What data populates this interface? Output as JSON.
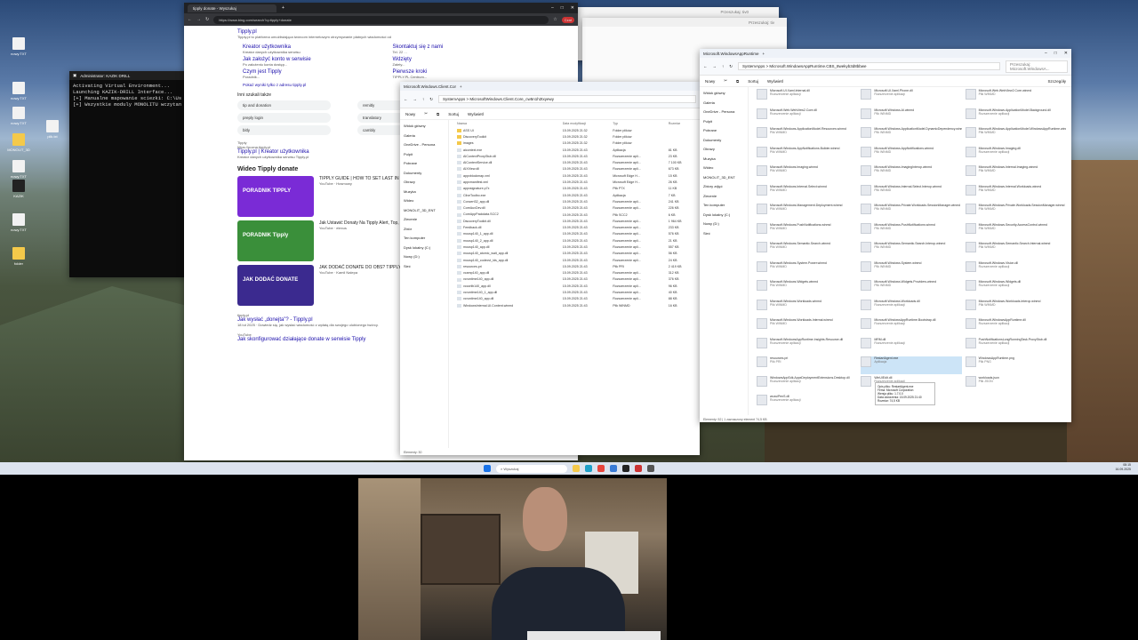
{
  "desktop": {
    "icons": [
      {
        "label": "nowy.TXT",
        "kind": "file"
      },
      {
        "label": "nowy.TXT",
        "kind": "file"
      },
      {
        "label": "nowy.TXT",
        "kind": "file"
      },
      {
        "label": "MONOLIT_3D",
        "kind": "folder"
      },
      {
        "label": "plik.txt",
        "kind": "file"
      },
      {
        "label": "nowy.TXT",
        "kind": "file"
      },
      {
        "label": "KAZIK",
        "kind": "dark"
      },
      {
        "label": "nowy.TXT",
        "kind": "file"
      },
      {
        "label": "folder",
        "kind": "folder"
      }
    ]
  },
  "terminal": {
    "title": "Administrator: KAZIK DRILL",
    "lines": "Activating Virtual Environment...\nLaunching KAZIK-DRILL Interface...\n[+] Manualne mapowanie sciezki: C:\\Us\n[+] Wszystkie moduly MONOLITU wczytan"
  },
  "browser": {
    "tab_title": "tipply donate - Wyszukaj",
    "url": "https://www.bing.com/search?q=tipply+donate",
    "top_link": "Tipply.pl",
    "top_desc": "Tipply.pl to platforma umożliwiająca twórcom internetowym otrzymywanie płatnych wiadomości od",
    "sublinks": [
      {
        "title": "Kreator użytkownika",
        "desc": "Kreator danych użytkownika serwisu"
      },
      {
        "title": "Skontaktuj się z nami",
        "desc": "Tel. 22 ..."
      },
      {
        "title": "Jak założyć konto w serwisie",
        "desc": "Po założeniu konta dostęp..."
      },
      {
        "title": "Wdzięty",
        "desc": "Zalety..."
      },
      {
        "title": "Czym jest Tipply",
        "desc": "Poradnik..."
      },
      {
        "title": "Pierwsze kroki",
        "desc": "TIPPLY.PL Centrum..."
      }
    ],
    "more_link": "Pokaż wyniki tylko z adresu tipply.pl",
    "also_searched": "Inni szukali także",
    "chips": [
      "tip and donation",
      "remitly",
      "preply login",
      "translatory",
      "bitly",
      "cambly"
    ],
    "result2_site": "Tipply",
    "result2_url": "https://pozna.tipply.pl",
    "result2_title": "Tipply.pl | Kreator użytkownika",
    "result2_desc": "Kreator danych użytkownika serwisu Tipply.pl",
    "video_heading": "Wideo Tipply donate",
    "videos": [
      {
        "title": "TIPPLY GUIDE | HOW TO SET LAST IN OBS",
        "source": "YouTube · Hosmowy",
        "thumb": "PORADNIK TIPPLY",
        "color": "#7a2bd6"
      },
      {
        "title": "Jak Ustawić Donaty Na Tipply Alert, Top, Last, Cel, Licznik",
        "source": "YouTube · elexus",
        "thumb": "PORADNIK Tipply",
        "color": "#3a8f3a"
      },
      {
        "title": "JAK DODAĆ DONATE DO OBS? TIPPLY",
        "source": "YouTube · Kamil Nalepa",
        "thumb": "JAK DODAĆ DONATE",
        "color": "#3b2a8f"
      }
    ],
    "result3_site": "tipply.pl",
    "result3_title": "Jak wysłać „donejta”? - Tipply.pl",
    "result3_desc": "18 lut 2025 · Dowiedz się, jak wysłać wiadomość z wpłatą dla swojego ulubionego twórcy.",
    "result4_site": "YouTube",
    "result4_title": "Jak skonfigurować działające donate w serwisie Tipply"
  },
  "explorer1": {
    "title": "Microsoft.Windows.Client.Cor",
    "breadcrumb": "SystemApps > MicrosoftWindows.Client.Core_cw5n1h2txyewy",
    "new_label": "Nowy",
    "sort_label": "Sortuj",
    "view_label": "Wyświetl",
    "side": [
      "Widok główny",
      "Galeria",
      "OneDrive - Persona",
      "Pulpit",
      "Pobrane",
      "Dokumenty",
      "Obrazy",
      "Muzyka",
      "Wideo",
      "MONOLIT_3D_ENT",
      "Zlecenie",
      "Zbiór",
      "Ten komputer",
      "Dysk lokalny (C:)",
      "Nowy (D:)",
      "Sieć"
    ],
    "headers": [
      "Nazwa",
      "Data modyfikacji",
      "Typ",
      "Rozmiar"
    ],
    "rows": [
      [
        "ASS UI",
        "15.09.2025 21:32",
        "Folder plików",
        "",
        "folder"
      ],
      [
        "DiscoveryToolkit",
        "15.09.2025 21:32",
        "Folder plików",
        "",
        "folder"
      ],
      [
        "images",
        "15.09.2025 21:32",
        "Folder plików",
        "",
        "folder"
      ],
      [
        "aicontext.exe",
        "15.09.2025 21:43",
        "Aplikacja",
        "81 KB",
        "file"
      ],
      [
        "AIContextProxyStub.dll",
        "15.09.2025 21:43",
        "Rozszerzenie apli...",
        "23 KB",
        "file"
      ],
      [
        "AIContextService.dll",
        "15.09.2025 21:43",
        "Rozszerzenie apli...",
        "7 100 KB",
        "file"
      ],
      [
        "AIXView.dll",
        "15.09.2025 21:43",
        "Rozszerzenie apli...",
        "673 KB",
        "file"
      ],
      [
        "appxblockmap.xml",
        "15.09.2025 21:43",
        "Microsoft Edge H...",
        "15 KB",
        "file"
      ],
      [
        "appxmanifest.xml",
        "15.09.2025 21:43",
        "Microsoft Edge H...",
        "26 KB",
        "file"
      ],
      [
        "appxsignature.p7x",
        "15.09.2025 21:43",
        "Plik P7X",
        "11 KB",
        "file"
      ],
      [
        "CliveToolbo.exe",
        "15.09.2025 21:43",
        "Aplikacja",
        "7 KB",
        "file"
      ],
      [
        "Concert32_app.dll",
        "15.09.2025 21:43",
        "Rozszerzenie apli...",
        "241 KB",
        "file"
      ],
      [
        "CoreAuxDev.dll",
        "15.09.2025 21:43",
        "Rozszerzenie apli...",
        "226 KB",
        "file"
      ],
      [
        "CoreAppPackdata.SCC2",
        "15.09.2025 21:43",
        "Plik SCC2",
        "6 KB",
        "file"
      ],
      [
        "DiscoveryToolkit.dll",
        "15.09.2025 21:43",
        "Rozszerzenie apli...",
        "1 964 KB",
        "file"
      ],
      [
        "Feedback.dll",
        "15.09.2025 21:43",
        "Rozszerzenie apli...",
        "233 KB",
        "file"
      ],
      [
        "mousp140_1_app.dll",
        "15.09.2025 21:43",
        "Rozszerzenie apli...",
        "576 KB",
        "file"
      ],
      [
        "mousp140_2_app.dll",
        "15.09.2025 21:43",
        "Rozszerzenie apli...",
        "21 KB",
        "file"
      ],
      [
        "mousp140_app.dll",
        "15.09.2025 21:43",
        "Rozszerzenie apli...",
        "557 KB",
        "file"
      ],
      [
        "mousp140_atomic_wait_app.dll",
        "15.09.2025 21:43",
        "Rozszerzenie apli...",
        "56 KB",
        "file"
      ],
      [
        "mousp140_codecvt_ids_app.dll",
        "15.09.2025 21:43",
        "Rozszerzenie apli...",
        "24 KB",
        "file"
      ],
      [
        "resources.pri",
        "15.09.2025 21:43",
        "Plik PRI",
        "2 419 KB",
        "file"
      ],
      [
        "vcamp140_app.dll",
        "15.09.2025 21:43",
        "Rozszerzenie apli...",
        "312 KB",
        "file"
      ],
      [
        "vcruntime140_app.dll",
        "15.09.2025 21:43",
        "Rozszerzenie apli...",
        "376 KB",
        "file"
      ],
      [
        "vccorlib140_app.dll",
        "15.09.2025 21:43",
        "Rozszerzenie apli...",
        "96 KB",
        "file"
      ],
      [
        "vcruntime140_1_app.dll",
        "15.09.2025 21:43",
        "Rozszerzenie apli...",
        "40 KB",
        "file"
      ],
      [
        "vcruntime140_app.dll",
        "15.09.2025 21:43",
        "Rozszerzenie apli...",
        "88 KB",
        "file"
      ],
      [
        "WindowsInternal.UI.Content.winmd",
        "15.09.2025 21:43",
        "Plik WINMD",
        "16 KB",
        "file"
      ]
    ],
    "status": "Elementy: 30"
  },
  "explorer2": {
    "title": "Microsoft.WindowsAppRuntime",
    "breadcrumb": "SystemApps > Microsoft.WindowsAppRuntime.CBS_8wekyb3d8bbwe",
    "search_placeholder": "Przeszukaj: Microsoft.WindowsA...",
    "details_label": "Szczegóły",
    "side": [
      "Widok główny",
      "Galeria",
      "OneDrive - Persona",
      "Pulpit",
      "Pobrane",
      "Dokumenty",
      "Obrazy",
      "Muzyka",
      "Wideo",
      "MONOLIT_3D_ENT",
      "Zbiory zdjęć",
      "Zlecenie",
      "Ten komputer",
      "Dysk lokalny (C:)",
      "Nowy (D:)",
      "Sieć"
    ],
    "items": [
      [
        "Microsoft.UI.Xaml.Internal.dll",
        "Rozszerzenie aplikacji"
      ],
      [
        "Microsoft.UI.Xaml.Phone.dll",
        "Rozszerzenie aplikacji"
      ],
      [
        "Microsoft.Web.WebView2.Core.winmd",
        "Plik WINMD"
      ],
      [
        "Microsoft.Web.WebView2.Core.dll",
        "Rozszerzenie aplikacji"
      ],
      [
        "Microsoft.Windows.AI.winmd",
        "Plik WINMD"
      ],
      [
        "Microsoft.Windows.ApplicationModel.Background.dll",
        "Rozszerzenie aplikacji"
      ],
      [
        "Microsoft.Windows.ApplicationModel.Resources.winmd",
        "Plik WINMD"
      ],
      [
        "Microsoft.Windows.ApplicationModel.DynamicDependency.winmd",
        "Plik WINMD"
      ],
      [
        "Microsoft.Windows.ApplicationModel.WindowsAppRuntime.winmd",
        "Plik WINMD"
      ],
      [
        "Microsoft.Windows.AppNotifications.Builder.winmd",
        "Plik WINMD"
      ],
      [
        "Microsoft.Windows.AppNotifications.winmd",
        "Plik WINMD"
      ],
      [
        "Microsoft.Windows.Imaging.dll",
        "Rozszerzenie aplikacji"
      ],
      [
        "Microsoft.Windows.Imaging.winmd",
        "Plik WINMD"
      ],
      [
        "Microsoft.Windows.ImagingInterop.winmd",
        "Plik WINMD"
      ],
      [
        "Microsoft.Windows.Internal.Imaging.winmd",
        "Plik WINMD"
      ],
      [
        "Microsoft.Windows.Internal.Select.winmd",
        "Plik WINMD"
      ],
      [
        "Microsoft.Windows.Internal.Select.Interop.winmd",
        "Plik WINMD"
      ],
      [
        "Microsoft.Windows.Internal.Workloads.winmd",
        "Plik WINMD"
      ],
      [
        "Microsoft.Windows.Management.Deployment.winmd",
        "Plik WINMD"
      ],
      [
        "Microsoft.Windows.Private.Workloads.SessionManager.winmd",
        "Plik WINMD"
      ],
      [
        "Microsoft.Windows.Private.Workloads.SessionManager.winmd",
        "Plik WINMD"
      ],
      [
        "Microsoft.Windows.PushNotifications.winmd",
        "Plik WINMD"
      ],
      [
        "Microsoft.Windows.PushNotifications.winmd",
        "Plik WINMD"
      ],
      [
        "Microsoft.Windows.Security.AccessControl.winmd",
        "Plik WINMD"
      ],
      [
        "Microsoft.Windows.Semantic.Search.winmd",
        "Plik WINMD"
      ],
      [
        "Microsoft.Windows.Semantic.Search.Interop.winmd",
        "Plik WINMD"
      ],
      [
        "Microsoft.Windows.Semantic.Search.Internal.winmd",
        "Plik WINMD"
      ],
      [
        "Microsoft.Windows.System.Power.winmd",
        "Plik WINMD"
      ],
      [
        "Microsoft.Windows.System.winmd",
        "Plik WINMD"
      ],
      [
        "Microsoft.Windows.Vision.dll",
        "Rozszerzenie aplikacji"
      ],
      [
        "Microsoft.Windows.Widgets.winmd",
        "Plik WINMD"
      ],
      [
        "Microsoft.Windows.Widgets.Providers.winmd",
        "Plik WINMD"
      ],
      [
        "Microsoft.Windows.Widgets.dll",
        "Rozszerzenie aplikacji"
      ],
      [
        "Microsoft.Windows.Workloads.winmd",
        "Plik WINMD"
      ],
      [
        "Microsoft.Windows.Workloads.dll",
        "Rozszerzenie aplikacji"
      ],
      [
        "Microsoft.Windows.Workloads.Interop.winmd",
        "Plik WINMD"
      ],
      [
        "Microsoft.Windows.Workloads.Internal.winmd",
        "Plik WINMD"
      ],
      [
        "Microsoft.WindowsAppRuntime.Bootstrap.dll",
        "Rozszerzenie aplikacji"
      ],
      [
        "Microsoft.WindowsAppRuntime.dll",
        "Rozszerzenie aplikacji"
      ],
      [
        "Microsoft.WindowsAppRuntime.Insights.Resource.dll",
        "Rozszerzenie aplikacji"
      ],
      [
        "MRM.dll",
        "Rozszerzenie aplikacji"
      ],
      [
        "PushNotificationsLongRunningTask.ProxyStub.dll",
        "Rozszerzenie aplikacji"
      ],
      [
        "resources.pri",
        "Plik PRI"
      ],
      [
        "RestartAgent.exe",
        "Aplikacja"
      ],
      [
        "WindowsAppRuntime.png",
        "Plik PNG"
      ],
      [
        "WindowsAppSdk.AppxDeploymentExtensions.Desktop.dll",
        "Rozszerzenie aplikacji"
      ],
      [
        "WinUIEdit.dll",
        "Rozszerzenie aplikacji"
      ],
      [
        "workloads.json",
        "Plik JSON"
      ],
      [
        "wuxuiPenS.dll",
        "Rozszerzenie aplikacji"
      ]
    ],
    "tooltip": "Opis pliku: RestartAgent.exe\nFirma: Microsoft Corporation\nWersja pliku: 1.7.0.0\nData utworzenia: 15.09.2025 21:40\nRozmiar: 74,5 KB",
    "status": "Elementy: 52  |  1 zaznaczony element  74,5 KB"
  },
  "bg_windows": {
    "title1": "Przeszukaj: tiv0",
    "title2": "Przeszukaj: tiv"
  },
  "taskbar": {
    "search": "Wyszukaj",
    "time": "08:15",
    "date": "16.09.2025"
  }
}
